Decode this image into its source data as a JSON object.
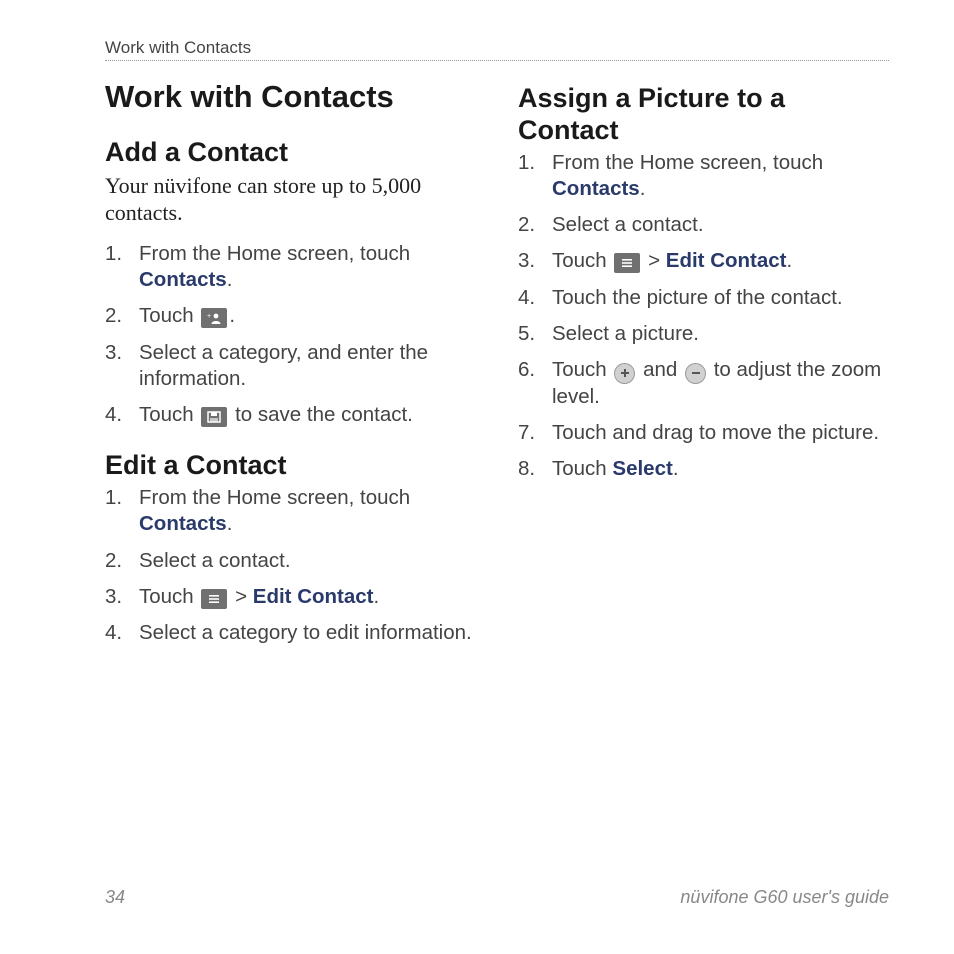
{
  "header": {
    "section": "Work with Contacts"
  },
  "chapter_title": "Work with Contacts",
  "left": {
    "add": {
      "title": "Add a Contact",
      "intro": "Your nüvifone can store up to 5,000 contacts.",
      "steps": {
        "s1_a": "From the Home screen, touch ",
        "s1_b": "Contacts",
        "s1_c": ".",
        "s2_a": "Touch ",
        "s2_b": ".",
        "s3": "Select a category, and enter the information.",
        "s4_a": "Touch ",
        "s4_b": " to save the contact."
      }
    },
    "edit": {
      "title": "Edit a Contact",
      "steps": {
        "s1_a": "From the Home screen, touch ",
        "s1_b": "Contacts",
        "s1_c": ".",
        "s2": "Select a contact.",
        "s3_a": "Touch ",
        "s3_b": " > ",
        "s3_c": "Edit Contact",
        "s3_d": ".",
        "s4": "Select a category to edit information."
      }
    }
  },
  "right": {
    "assign": {
      "title": "Assign a Picture to a Contact",
      "steps": {
        "s1_a": "From the Home screen, touch ",
        "s1_b": "Contacts",
        "s1_c": ".",
        "s2": "Select a contact.",
        "s3_a": "Touch ",
        "s3_b": " > ",
        "s3_c": "Edit Contact",
        "s3_d": ".",
        "s4": "Touch the picture of the contact.",
        "s5": "Select a picture.",
        "s6_a": "Touch ",
        "s6_b": " and ",
        "s6_c": " to adjust the zoom level.",
        "s7": "Touch and drag to move the picture.",
        "s8_a": "Touch ",
        "s8_b": "Select",
        "s8_c": "."
      }
    }
  },
  "footer": {
    "page_number": "34",
    "doc_title": "nüvifone G60 user's guide"
  }
}
